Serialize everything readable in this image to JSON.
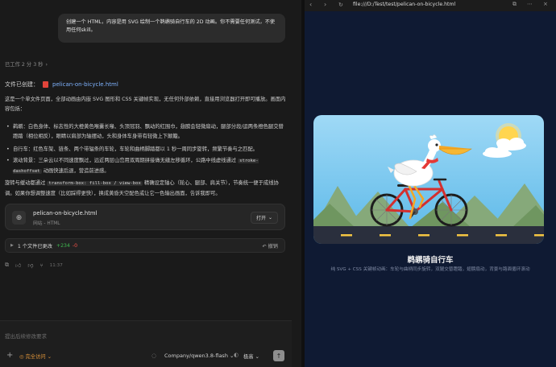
{
  "chat": {
    "user_message": "创建一个 HTML，内容是用 SVG 绘制一个鹈鹕骑自行车的 2D 动画。你不需要任何测试，不使用任何skill。",
    "worked_label": "已工作 2 分 3 秒",
    "file_created_label": "文件已创建：",
    "file_created_name": "pelican-on-bicycle.html",
    "intro": "这是一个单文件页面，全部动画由内嵌 SVG 图形和 CSS 关键帧实现，无任何外部依赖，直接用浏览器打开即可播放。画面内容包括：",
    "bullets": [
      "鹈鹕：白色身体、标志性的大橙黄色喉囊长喙、头顶冠羽、飘动的红围巾，翅膀会轻微扇动，腿部分段/运两条橙色腿交替蹬踏（相位相反），眼睛以肩部为轴摆动，头和身体车身带有轻微上下颠簸。",
      "自行车：红色车架、链条、两个带辐条的车轮，车轮和曲柄脚踏都以 1 秒一周同步旋转，频繁节奏与之匹配。",
      "滚动背景：三朵云以不同速度飘过，远近两层山峦用双周期拼接做无缝左移循环，公路中线虚线通过"
    ],
    "bullet3_code": "stroke-dashoffset",
    "bullet3_tail": "动画快速后退，营造前进感。",
    "para2_a": "旋转与缓动都通过",
    "para2_code": "transform-box: fill-box / view-box",
    "para2_b": "精确设定轴心（轮心、腿部、肩关节），节奏统一便于成线协调。如果你想调整速度（比如踩得更快），换成黄昏天空配色或让它一色输出画面，告诉我即可。",
    "file_card_name": "pelican-on-bicycle.html",
    "file_card_type": "网站 - HTML",
    "open_label": "打开",
    "changes_label": "1 个文件已更改",
    "added": "+234",
    "removed": "-0",
    "undo_label": "撤销",
    "time": "11:37"
  },
  "composer": {
    "placeholder": "提出后续修改要求",
    "access_label": "完全访问",
    "model_label": "Company/qwen3.8-flash",
    "level_label": "极高"
  },
  "browser": {
    "url": "file:///D:/Test/test/pelican-on-bicycle.html",
    "page_title": "鹈鹕骑自行车",
    "page_subtitle": "纯 SVG + CSS 关键帧动画：车轮与曲柄同步旋转，双腿交替蹬踏，翅膀扇动，背景与路面循环滚动"
  },
  "colors": {
    "sky": "#7ec8f0",
    "scarf": "#e53935",
    "bike_frame": "#d32f2f",
    "beak": "#f5a623",
    "road": "#2a2f3d",
    "sun": "#ffd54f",
    "hill_far": "#86a97a",
    "hill_near": "#6f9660"
  }
}
